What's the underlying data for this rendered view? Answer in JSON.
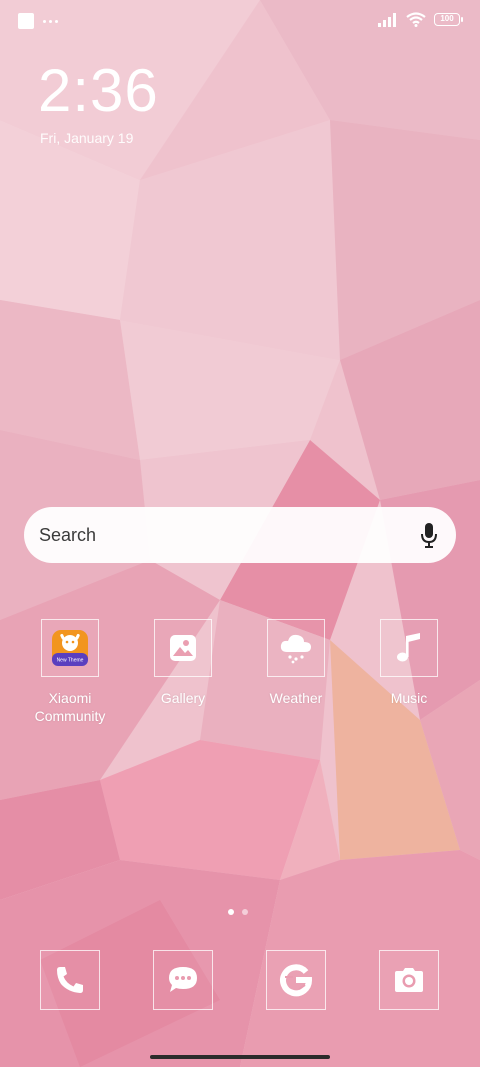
{
  "status_bar": {
    "battery_level": "100",
    "signal_bars": 4,
    "wifi_bars": 3
  },
  "clock": {
    "time": "2:36",
    "date": "Fri, January 19"
  },
  "search": {
    "placeholder": "Search",
    "mic_icon": "microphone-icon"
  },
  "apps": [
    {
      "label": "Xiaomi Community",
      "icon": "xiaomi-community-icon",
      "badge_text": "New Theme"
    },
    {
      "label": "Gallery",
      "icon": "gallery-icon"
    },
    {
      "label": "Weather",
      "icon": "weather-snow-cloud-icon"
    },
    {
      "label": "Music",
      "icon": "music-note-icon"
    }
  ],
  "pages": {
    "count": 2,
    "active": 1
  },
  "dock": [
    {
      "icon": "phone-icon"
    },
    {
      "icon": "messages-icon"
    },
    {
      "icon": "browser-g-icon"
    },
    {
      "icon": "camera-icon"
    }
  ],
  "colors": {
    "wallpaper_base": "#efbfcb",
    "wallpaper_dark": "#e78fa5",
    "wallpaper_light": "#f4d4dc",
    "icon_orange": "#f2951f",
    "icon_purple": "#5a3fbf"
  }
}
